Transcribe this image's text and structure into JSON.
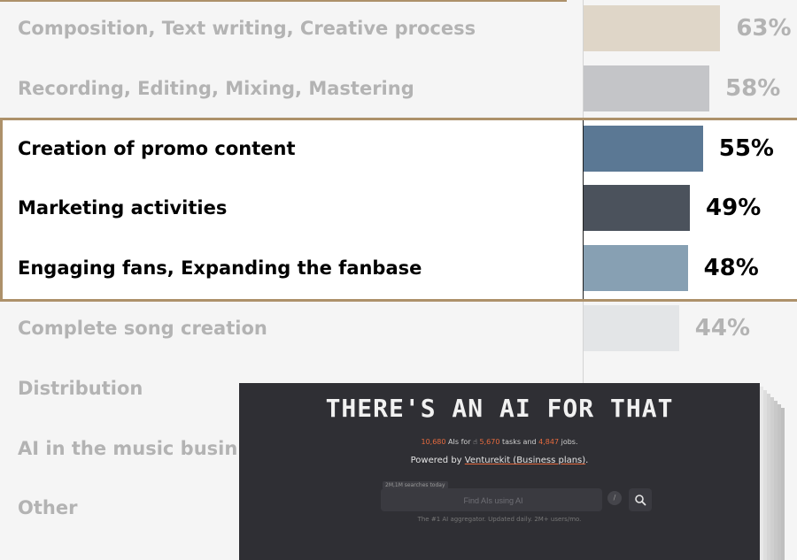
{
  "chart_data": {
    "type": "bar",
    "orientation": "horizontal",
    "categories": [
      "Composition, Text writing, Creative process",
      "Recording, Editing, Mixing, Mastering",
      "Creation of promo content",
      "Marketing activities",
      "Engaging fans, Expanding the fanbase",
      "Complete song creation",
      "Distribution",
      "AI in the music busin",
      "Other"
    ],
    "values": [
      63,
      58,
      55,
      49,
      48,
      44,
      null,
      null,
      null
    ],
    "value_labels": [
      "63%",
      "58%",
      "55%",
      "49%",
      "48%",
      "44%",
      "",
      "",
      ""
    ],
    "highlighted": [
      false,
      false,
      true,
      true,
      true,
      false,
      false,
      false,
      false
    ],
    "bar_colors": [
      "#dfd6c8",
      "#c4c5c8",
      "#5b7894",
      "#4b525c",
      "#87a0b3",
      "#e3e5e7",
      "#e6e6e6",
      "#f0f0f0",
      "#f0f0f0"
    ],
    "xlim": [
      0,
      100
    ],
    "highlight_border_color": "#ad916a"
  },
  "overlay": {
    "title": "THERE'S AN AI FOR THAT",
    "stats_prefix": "10,680",
    "stats_text1": " AIs for ",
    "stats_icon": "hand-icon",
    "stats_tasks": "5,670",
    "stats_text2": " tasks and ",
    "stats_jobs": "4,847",
    "stats_text3": " jobs.",
    "powered_prefix": "Powered by ",
    "powered_link": "Venturekit (Business plans)",
    "powered_suffix": ".",
    "searches_badge": "2M,1M searches today",
    "search_placeholder": "Find AIs using AI",
    "slash_key": "/",
    "tagline": "The #1 AI aggregator. Updated daily. 2M+ users/mo.",
    "background_color": "#2f2f34"
  }
}
